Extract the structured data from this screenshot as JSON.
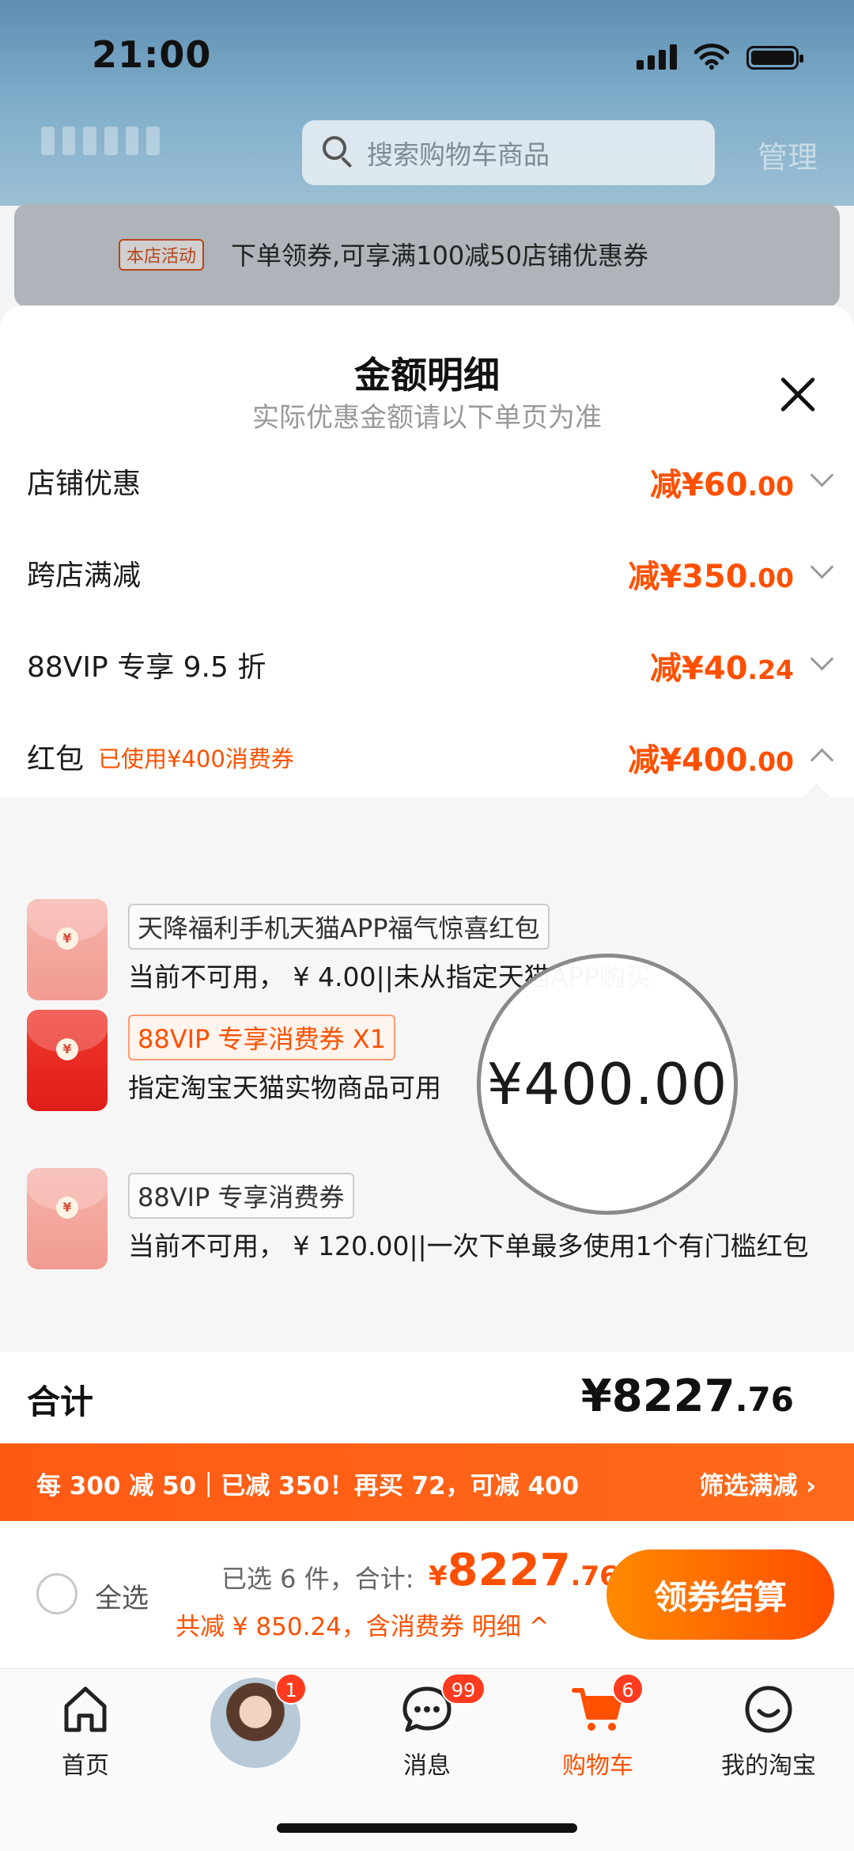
{
  "status_bar": {
    "time": "21:00"
  },
  "header": {
    "search_placeholder": "搜索购物车商品",
    "manage_label": "管理"
  },
  "promo": {
    "tag": "本店活动",
    "text": "下单领券,可享满100减50店铺优惠券"
  },
  "sheet": {
    "title": "金额明细",
    "subtitle": "实际优惠金额请以下单页为准",
    "rows": [
      {
        "label": "店铺优惠",
        "note": "",
        "amount_main": "减¥60",
        "amount_dec": ".00",
        "expanded": false
      },
      {
        "label": "跨店满减",
        "note": "",
        "amount_main": "减¥350",
        "amount_dec": ".00",
        "expanded": false
      },
      {
        "label": "88VIP 专享 9.5 折",
        "note": "",
        "amount_main": "减¥40",
        "amount_dec": ".24",
        "expanded": false
      },
      {
        "label": "红包",
        "note": "已使用¥400消费券",
        "amount_main": "减¥400",
        "amount_dec": ".00",
        "expanded": true
      }
    ],
    "red_packets": [
      {
        "tag": "天降福利手机天猫APP福气惊喜红包",
        "desc": "当前不可用， ¥ 4.00||未从指定天猫APP购买",
        "available": false
      },
      {
        "tag": "88VIP 专享消费券 X1",
        "desc": "指定淘宝天猫实物商品可用",
        "available": true
      },
      {
        "tag": "88VIP 专享消费券",
        "desc": "当前不可用， ¥ 120.00||一次下单最多使用1个有门槛红包",
        "available": false
      }
    ],
    "magnifier_text": "¥400.00",
    "total_label": "合计",
    "total_main": "¥8227",
    "total_dec": ".76"
  },
  "discount_bar": {
    "text": "每 300 减 50｜已减 350！再买 72，可减 400",
    "link": "筛选满减 ›"
  },
  "checkout": {
    "select_all": "全选",
    "selected_count": "已选 6 件，合计:",
    "total_symbol": "¥",
    "total_main": "8227",
    "total_dec": ".76",
    "saved": "共减 ¥ 850.24，含消费券  明细 ^",
    "button": "领券结算"
  },
  "tabs": [
    {
      "label": "首页",
      "icon": "home-icon",
      "badge": ""
    },
    {
      "label": "",
      "icon": "avatar",
      "badge": "1"
    },
    {
      "label": "消息",
      "icon": "message-icon",
      "badge": "99"
    },
    {
      "label": "购物车",
      "icon": "cart-icon",
      "badge": "6",
      "active": true
    },
    {
      "label": "我的淘宝",
      "icon": "my-taobao-icon",
      "badge": ""
    }
  ],
  "colors": {
    "accent": "#ff5000",
    "discount_bar": "#ff5a14"
  }
}
